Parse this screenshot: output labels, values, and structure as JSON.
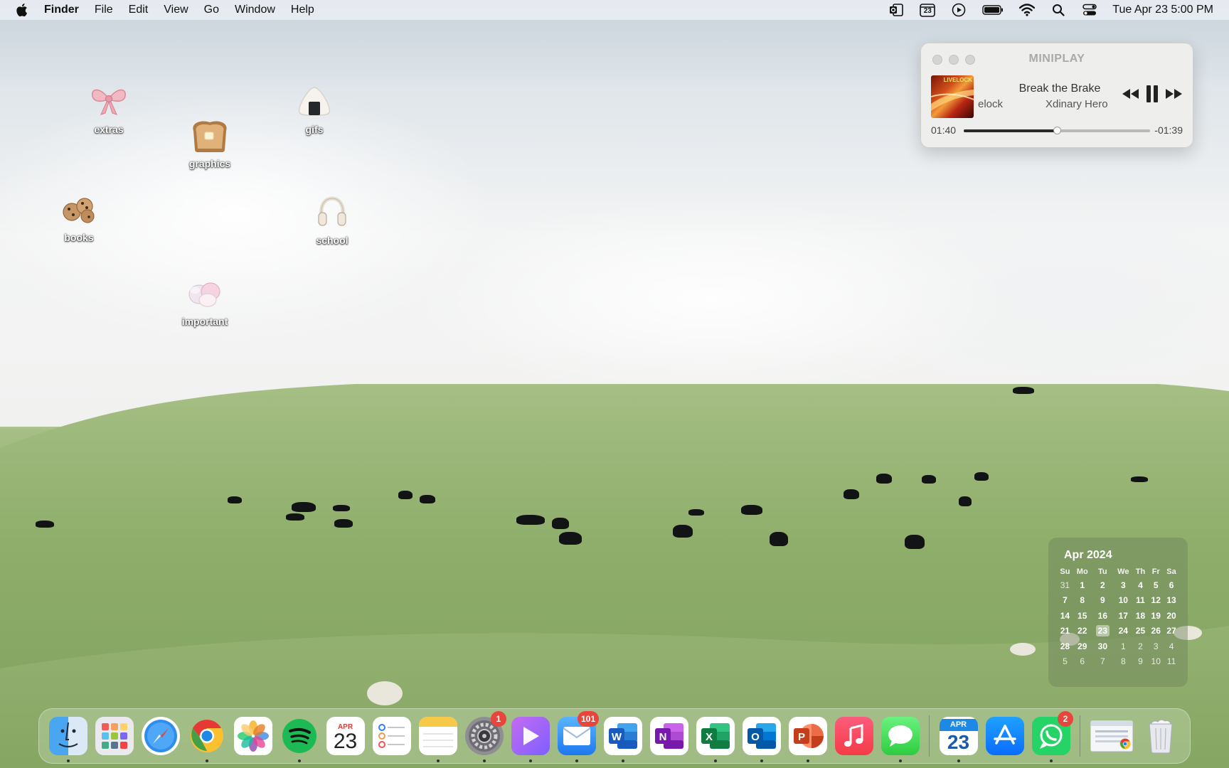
{
  "menubar": {
    "app_name": "Finder",
    "menus": [
      "File",
      "Edit",
      "View",
      "Go",
      "Window",
      "Help"
    ],
    "status_icons": [
      "outlook-icon",
      "calendar-icon",
      "play-icon",
      "battery-icon",
      "wifi-icon",
      "search-icon",
      "control-center-icon"
    ],
    "calendar_icon_day": "23",
    "clock": "Tue Apr 23  5:00 PM"
  },
  "desktop_icons": [
    {
      "label": "extras",
      "icon": "ribbon-icon"
    },
    {
      "label": "graphics",
      "icon": "toast-icon"
    },
    {
      "label": "gifs",
      "icon": "onigiri-icon"
    },
    {
      "label": "books",
      "icon": "cookies-icon"
    },
    {
      "label": "school",
      "icon": "headphones-icon"
    },
    {
      "label": "important",
      "icon": "marshmallow-icon"
    }
  ],
  "miniplay": {
    "title": "MINIPLAY",
    "art_text": "LIVELOCK",
    "track": "Break the Brake",
    "album": "elock",
    "artist": "Xdinary Hero",
    "elapsed": "01:40",
    "remaining": "-01:39",
    "progress": 0.5
  },
  "calendar": {
    "title": "Apr 2024",
    "weekdays": [
      "Su",
      "Mo",
      "Tu",
      "We",
      "Th",
      "Fr",
      "Sa"
    ],
    "weeks": [
      [
        "31",
        "1",
        "2",
        "3",
        "4",
        "5",
        "6"
      ],
      [
        "7",
        "8",
        "9",
        "10",
        "11",
        "12",
        "13"
      ],
      [
        "14",
        "15",
        "16",
        "17",
        "18",
        "19",
        "20"
      ],
      [
        "21",
        "22",
        "23",
        "24",
        "25",
        "26",
        "27"
      ],
      [
        "28",
        "29",
        "30",
        "1",
        "2",
        "3",
        "4"
      ],
      [
        "5",
        "6",
        "7",
        "8",
        "9",
        "10",
        "11"
      ]
    ],
    "today": "23"
  },
  "dock": {
    "items": [
      {
        "name": "finder",
        "running": true
      },
      {
        "name": "launchpad",
        "running": false
      },
      {
        "name": "safari",
        "running": false
      },
      {
        "name": "chrome",
        "running": true
      },
      {
        "name": "photos",
        "running": false
      },
      {
        "name": "spotify",
        "running": true
      },
      {
        "name": "calendar",
        "running": false,
        "month": "APR",
        "day": "23"
      },
      {
        "name": "reminders",
        "running": false
      },
      {
        "name": "notes",
        "running": true
      },
      {
        "name": "system-settings",
        "running": true,
        "badge": "1"
      },
      {
        "name": "infuse",
        "running": true
      },
      {
        "name": "mail",
        "running": true,
        "badge": "101"
      },
      {
        "name": "word",
        "running": true
      },
      {
        "name": "onenote",
        "running": false
      },
      {
        "name": "excel",
        "running": true
      },
      {
        "name": "outlook",
        "running": true
      },
      {
        "name": "powerpoint",
        "running": true
      },
      {
        "name": "music",
        "running": false
      },
      {
        "name": "messages",
        "running": true
      }
    ],
    "recent_items": [
      {
        "name": "calendar-widget",
        "running": true,
        "month": "APR",
        "day": "23"
      },
      {
        "name": "app-store",
        "running": false
      },
      {
        "name": "whatsapp",
        "running": true,
        "badge": "2"
      }
    ],
    "trailing_items": [
      {
        "name": "chrome-window"
      },
      {
        "name": "trash"
      }
    ]
  },
  "colors": {
    "badge": "#e8453c",
    "grass": "#8eae6a",
    "sky": "#dfe5ea"
  }
}
